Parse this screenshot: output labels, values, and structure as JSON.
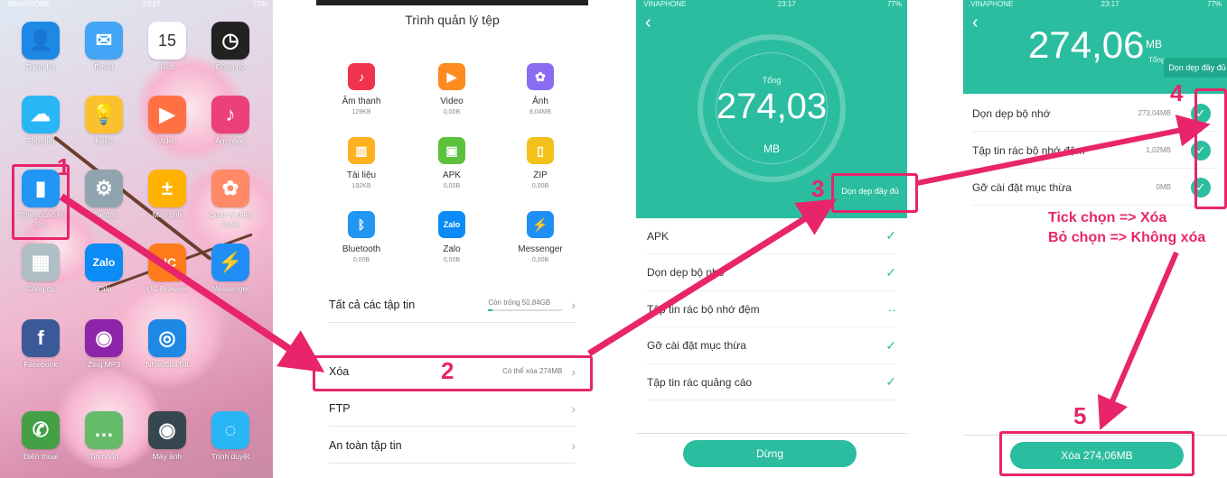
{
  "home": {
    "status": {
      "carrier": ".VINAPHONE",
      "time": "23:17",
      "battery": "77%"
    },
    "apps": [
      {
        "label": "Danh bạ",
        "icon": "contacts-icon",
        "color": "#1e88e5",
        "glyph": "👤"
      },
      {
        "label": "Email",
        "icon": "mail-icon",
        "color": "#42a5f5",
        "glyph": "✉"
      },
      {
        "label": "Lịch",
        "icon": "calendar-icon",
        "color": "#ffffff",
        "glyph": "15",
        "cal_day": "Chủ Nhật"
      },
      {
        "label": "Đồng hồ",
        "icon": "clock-icon",
        "color": "#222222",
        "glyph": "◷"
      },
      {
        "label": "Thời tiết",
        "icon": "weather-icon",
        "color": "#29b6f6",
        "glyph": "☁"
      },
      {
        "label": "Keep",
        "icon": "lightbulb-icon",
        "color": "#fbc02d",
        "glyph": "💡"
      },
      {
        "label": "Video",
        "icon": "video-play-icon",
        "color": "#ff7043",
        "glyph": "▶"
      },
      {
        "label": "Âm nhạc",
        "icon": "music-note-icon",
        "color": "#ec407a",
        "glyph": "♪"
      },
      {
        "label": "Trình quản lý tệp",
        "icon": "file-manager-icon",
        "color": "#2196f3",
        "glyph": "▮"
      },
      {
        "label": "Cài đặt",
        "icon": "settings-gear-icon",
        "color": "#90a4ae",
        "glyph": "⚙"
      },
      {
        "label": "Máy tính",
        "icon": "calculator-icon",
        "color": "#ffb300",
        "glyph": "±"
      },
      {
        "label": "Quản lý điện thoại",
        "icon": "phone-manager-icon",
        "color": "#ff8a65",
        "glyph": "✿"
      },
      {
        "label": "Công cụ",
        "icon": "tools-folder-icon",
        "color": "#b0bec5",
        "glyph": "▦"
      },
      {
        "label": "Zalo",
        "icon": "zalo-icon",
        "color": "#0a8bf5",
        "glyph": "Zalo"
      },
      {
        "label": "UC Browser",
        "icon": "uc-browser-icon",
        "color": "#ff7a1a",
        "glyph": "UC"
      },
      {
        "label": "Messenger",
        "icon": "messenger-icon",
        "color": "#1f8ef5",
        "glyph": "⚡"
      },
      {
        "label": "Facebook",
        "icon": "facebook-icon",
        "color": "#3b5998",
        "glyph": "f"
      },
      {
        "label": "Zing MP3",
        "icon": "zing-mp3-icon",
        "color": "#8e24aa",
        "glyph": "◉"
      },
      {
        "label": "NhacCuaTui",
        "icon": "nhaccuatui-icon",
        "color": "#1e88e5",
        "glyph": "◎"
      },
      {
        "label": "",
        "icon": "",
        "color": "",
        "glyph": ""
      },
      {
        "label": "Điện thoại",
        "icon": "phone-icon",
        "color": "#43a047",
        "glyph": "✆"
      },
      {
        "label": "Tin nhắn",
        "icon": "messages-icon",
        "color": "#66bb6a",
        "glyph": "…"
      },
      {
        "label": "Máy ảnh",
        "icon": "camera-icon",
        "color": "#37474f",
        "glyph": "◉"
      },
      {
        "label": "Trình duyệt",
        "icon": "browser-icon",
        "color": "#29b6f6",
        "glyph": "◌"
      }
    ]
  },
  "file_manager": {
    "title": "Trình quản lý tệp",
    "categories": [
      {
        "name": "Âm thanh",
        "size": "129KB",
        "icon": "audio-icon",
        "color": "#f0344f",
        "glyph": "♪"
      },
      {
        "name": "Video",
        "size": "0,00B",
        "icon": "video-icon",
        "color": "#ff8a1f",
        "glyph": "▶"
      },
      {
        "name": "Ảnh",
        "size": "8,04MB",
        "icon": "photo-icon",
        "color": "#8a6cf0",
        "glyph": "✿"
      },
      {
        "name": "Tài liệu",
        "size": "192KB",
        "icon": "document-icon",
        "color": "#ffb11f",
        "glyph": "▥"
      },
      {
        "name": "APK",
        "size": "0,00B",
        "icon": "android-apk-icon",
        "color": "#5cc13d",
        "glyph": "▣"
      },
      {
        "name": "ZIP",
        "size": "0,00B",
        "icon": "zip-icon",
        "color": "#f2c21b",
        "glyph": "▯"
      },
      {
        "name": "Bluetooth",
        "size": "0,00B",
        "icon": "bluetooth-icon",
        "color": "#2196f3",
        "glyph": "ᛒ"
      },
      {
        "name": "Zalo",
        "size": "0,00B",
        "icon": "zalo-icon",
        "color": "#0a8bf5",
        "glyph": "Zalo"
      },
      {
        "name": "Messenger",
        "size": "0,00B",
        "icon": "messenger-icon",
        "color": "#1f8ef5",
        "glyph": "⚡"
      }
    ],
    "all_files": {
      "label": "Tất cả các tập tin",
      "free": "Còn trống 50,84GB"
    },
    "clean": {
      "label": "Xóa",
      "info": "Có thể xóa 274MB"
    },
    "ftp": {
      "label": "FTP"
    },
    "safe": {
      "label": "An toàn tập tin"
    }
  },
  "scan": {
    "status": {
      "carrier": ".VINAPHONE",
      "time": "23:17",
      "battery": "77%"
    },
    "total_label": "Tổng",
    "total_value": "274,03",
    "unit": "MB",
    "full_clean_button": "Dọn dẹp đầy đủ",
    "items": [
      {
        "label": "APK"
      },
      {
        "label": "Dọn dẹp bộ nhớ"
      },
      {
        "label": "Tập tin rác bộ nhớ đệm"
      },
      {
        "label": "Gỡ cài đặt mục thừa"
      },
      {
        "label": "Tập tin rác quảng cáo"
      }
    ],
    "stop_button": "Dừng"
  },
  "confirm": {
    "status": {
      "carrier": ".VINAPHONE",
      "time": "23:17",
      "battery": "77%"
    },
    "total_value": "274,06",
    "unit": "MB",
    "total_label": "Tổng",
    "full_clean_button": "Dọn dẹp đầy đủ",
    "items": [
      {
        "label": "Dọn dẹp bộ nhớ",
        "size": "273,04MB"
      },
      {
        "label": "Tập tin rác bộ nhớ đệm",
        "size": "1,02MB"
      },
      {
        "label": "Gỡ cài đặt mục thừa",
        "size": "0MB"
      }
    ],
    "delete_button": "Xóa 274,06MB"
  },
  "annotations": {
    "steps": [
      "1",
      "2",
      "3",
      "4",
      "5"
    ],
    "note_line1": "Tick chọn => Xóa",
    "note_line2": "Bỏ chọn => Không xóa",
    "color": "#e8256a"
  }
}
